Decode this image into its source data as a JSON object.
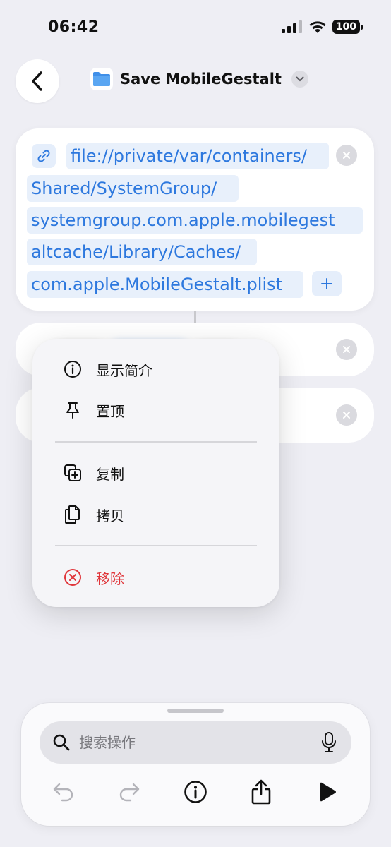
{
  "status_bar": {
    "time": "06:42",
    "battery": "100"
  },
  "header": {
    "title": "Save MobileGestalt"
  },
  "path_card": {
    "lines": [
      "file://private/var/containers/",
      "Shared/SystemGroup/",
      "systemgroup.com.apple.mobilegest",
      "altcache/Library/Caches/",
      "com.apple.MobileGestalt.plist"
    ]
  },
  "context_menu": {
    "items": [
      {
        "label": "显示简介",
        "icon": "info-circle-icon"
      },
      {
        "label": "置顶",
        "icon": "pin-icon"
      },
      {
        "label": "复制",
        "icon": "duplicate-icon"
      },
      {
        "label": "拷贝",
        "icon": "copy-icon"
      },
      {
        "label": "移除",
        "icon": "remove-circle-icon",
        "destructive": true
      }
    ]
  },
  "search": {
    "placeholder": "搜索操作"
  },
  "toolbar": {
    "buttons": [
      "undo-icon",
      "redo-icon",
      "info-icon",
      "share-icon",
      "play-icon"
    ]
  },
  "colors": {
    "accent": "#2d78de",
    "destructive": "#e0353a",
    "chip_bg": "#e8f0fb"
  }
}
